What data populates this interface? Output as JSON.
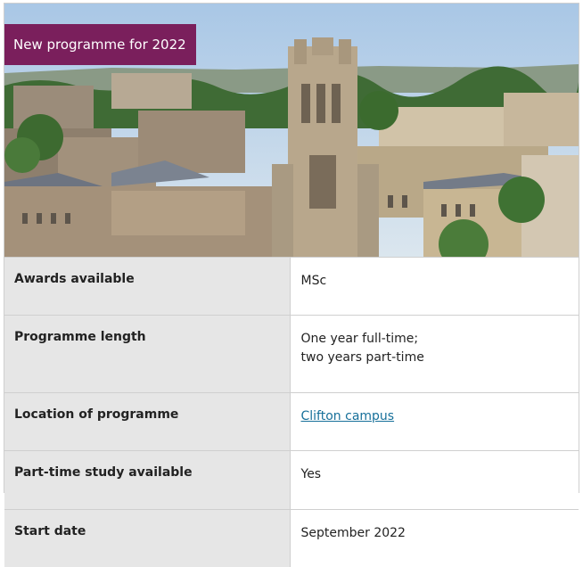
{
  "badge": "New programme for 2022",
  "hero": {
    "image_description_icon": "university-skyline-photo"
  },
  "facts": [
    {
      "label": "Awards available",
      "value": "MSc"
    },
    {
      "label": "Programme length",
      "value_lines": [
        "One year full-time;",
        "two years part-time"
      ]
    },
    {
      "label": "Location of programme",
      "value": "Clifton campus",
      "is_link": true
    },
    {
      "label": "Part-time study available",
      "value": "Yes"
    },
    {
      "label": "Start date",
      "value": "September 2022"
    }
  ],
  "colors": {
    "badge_bg": "#7a1f5c",
    "link": "#17709a",
    "label_bg": "#e6e6e6"
  }
}
